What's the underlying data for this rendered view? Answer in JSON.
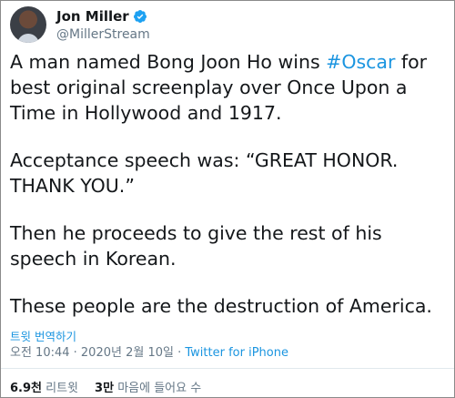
{
  "author": {
    "name": "Jon Miller",
    "handle": "@MillerStream"
  },
  "tweet": {
    "line1_pre": "A man named Bong Joon Ho wins ",
    "line1_hashtag": "#Oscar",
    "line1_post": " for best original screenplay over Once Upon a Time in Hollywood and 1917.",
    "para2": "Acceptance speech was: “GREAT HONOR. THANK YOU.”",
    "para3": "Then he proceeds to give the rest of his speech in Korean.",
    "para4": "These people are the destruction of America."
  },
  "translate_label": "트윗 번역하기",
  "meta": {
    "timestamp": "오전 10:44 · 2020년 2월 10일",
    "separator": " · ",
    "app": "Twitter for iPhone"
  },
  "stats": {
    "retweets_count": "6.9천",
    "retweets_label": "리트윗",
    "likes_count": "3만",
    "likes_label": "마음에 들어요 수"
  },
  "colors": {
    "link": "#1b95e0",
    "verified": "#1da1f2",
    "secondary_text": "#657786"
  }
}
